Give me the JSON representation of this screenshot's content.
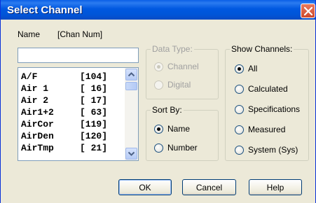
{
  "window": {
    "title": "Select Channel",
    "close_glyph": "×"
  },
  "header": {
    "name_label": "Name",
    "num_label": "[Chan Num]"
  },
  "name_input": {
    "value": ""
  },
  "channels": [
    {
      "name": "A/F",
      "num": "[104]"
    },
    {
      "name": "Air 1",
      "num": "[ 16]"
    },
    {
      "name": "Air 2",
      "num": "[ 17]"
    },
    {
      "name": "Air1+2",
      "num": "[ 63]"
    },
    {
      "name": "AirCor",
      "num": "[119]"
    },
    {
      "name": "AirDen",
      "num": "[120]"
    },
    {
      "name": "AirTmp",
      "num": "[ 21]"
    }
  ],
  "data_type": {
    "title": "Data Type:",
    "options": [
      {
        "label": "Channel",
        "checked": true
      },
      {
        "label": "Digital",
        "checked": false
      }
    ]
  },
  "sort_by": {
    "title": "Sort By:",
    "options": [
      {
        "label": "Name",
        "checked": true
      },
      {
        "label": "Number",
        "checked": false
      }
    ]
  },
  "show_channels": {
    "title": "Show Channels:",
    "options": [
      {
        "label": "All",
        "checked": true
      },
      {
        "label": "Calculated",
        "checked": false
      },
      {
        "label": "Specifications",
        "checked": false
      },
      {
        "label": "Measured",
        "checked": false
      },
      {
        "label": "System (Sys)",
        "checked": false
      }
    ]
  },
  "buttons": {
    "ok": "OK",
    "cancel": "Cancel",
    "help": "Help"
  }
}
